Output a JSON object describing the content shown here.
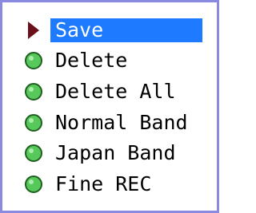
{
  "menu": {
    "items": [
      {
        "label": "Save",
        "selected": true,
        "marker": "triangle-right-icon"
      },
      {
        "label": "Delete",
        "selected": false,
        "marker": "green-dot-icon"
      },
      {
        "label": "Delete All",
        "selected": false,
        "marker": "green-dot-icon"
      },
      {
        "label": "Normal Band",
        "selected": false,
        "marker": "green-dot-icon"
      },
      {
        "label": "Japan Band",
        "selected": false,
        "marker": "green-dot-icon"
      },
      {
        "label": "Fine REC",
        "selected": false,
        "marker": "green-dot-icon"
      }
    ]
  },
  "colors": {
    "border": "#8a8ae0",
    "selection_bg": "#1e7bff",
    "selection_text": "#ffffff",
    "arrow": "#6b0f1a",
    "dot_green": "#57c85a"
  }
}
